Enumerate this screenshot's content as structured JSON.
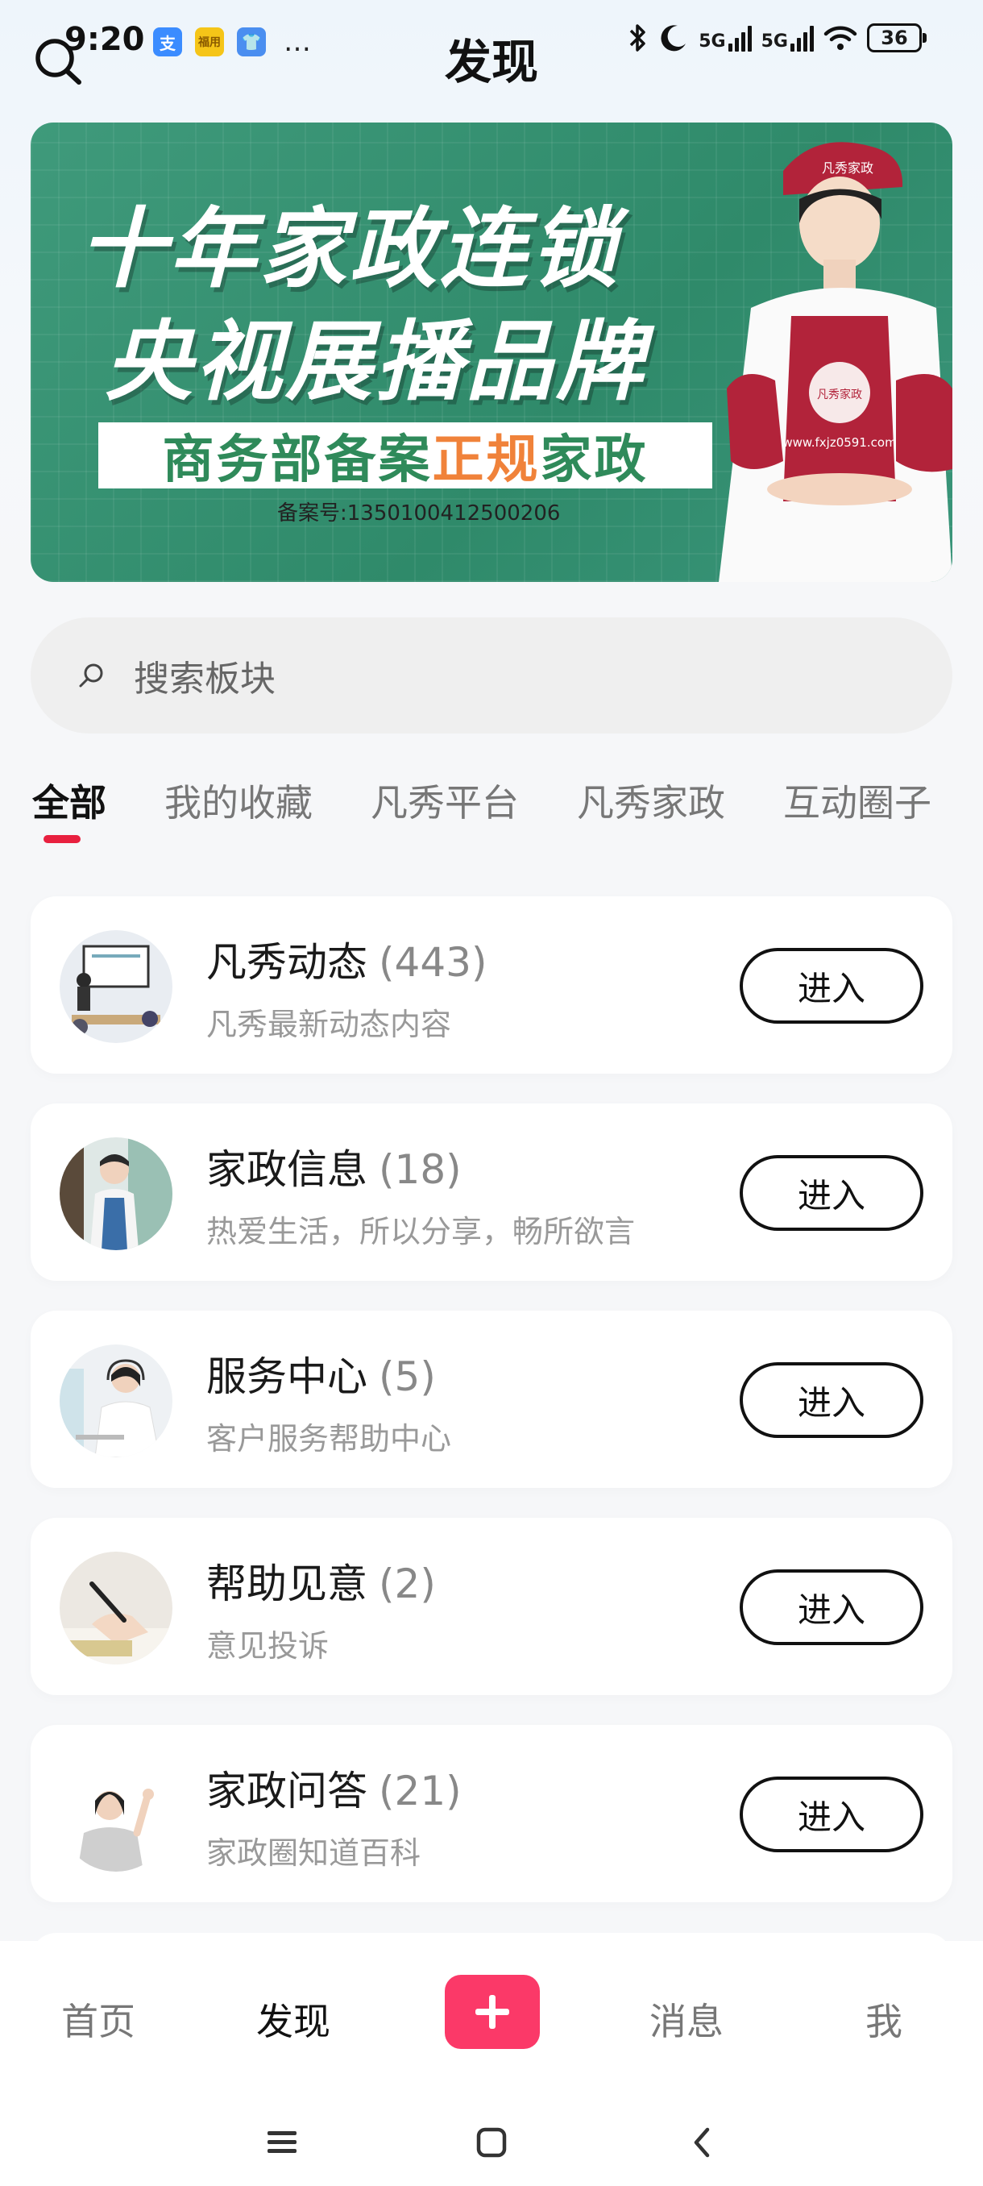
{
  "status_bar": {
    "time": "9:20",
    "apps": [
      "支",
      "福用",
      "👕"
    ],
    "more": "…",
    "network": [
      "5G",
      "5G"
    ],
    "battery": "36"
  },
  "header": {
    "title": "发现"
  },
  "banner": {
    "line1": "十年家政连锁",
    "line2": "央视展播品牌",
    "strip_part1": "商务部备案",
    "strip_part2": "正规",
    "strip_part3": "家政",
    "record": "备案号:1350100412500206",
    "badge_text": "凡秀家政",
    "apron_url": "www.fxjz0591.com",
    "colors": {
      "background": "#3a957a",
      "apron": "#b2233a"
    }
  },
  "search": {
    "placeholder": "搜索板块"
  },
  "tabs": [
    {
      "label": "全部",
      "active": true
    },
    {
      "label": "我的收藏",
      "active": false
    },
    {
      "label": "凡秀平台",
      "active": false
    },
    {
      "label": "凡秀家政",
      "active": false
    },
    {
      "label": "互动圈子",
      "active": false
    }
  ],
  "boards": [
    {
      "title": "凡秀动态",
      "count": "(443)",
      "desc": "凡秀最新动态内容",
      "button": "进入"
    },
    {
      "title": "家政信息",
      "count": "(18)",
      "desc": "热爱生活，所以分享，畅所欲言",
      "button": "进入"
    },
    {
      "title": "服务中心",
      "count": "(5)",
      "desc": "客户服务帮助中心",
      "button": "进入"
    },
    {
      "title": "帮助见意",
      "count": "(2)",
      "desc": "意见投诉",
      "button": "进入"
    },
    {
      "title": "家政问答",
      "count": "(21)",
      "desc": "家政圈知道百科",
      "button": "进入"
    }
  ],
  "bottom_nav": {
    "home": "首页",
    "discover": "发现",
    "add": "+",
    "messages": "消息",
    "me": "我",
    "accent": "#fb3968"
  },
  "icons": {
    "search": "search-icon",
    "menu": "menu-icon",
    "home": "home-square-icon",
    "back": "back-chevron-icon"
  }
}
